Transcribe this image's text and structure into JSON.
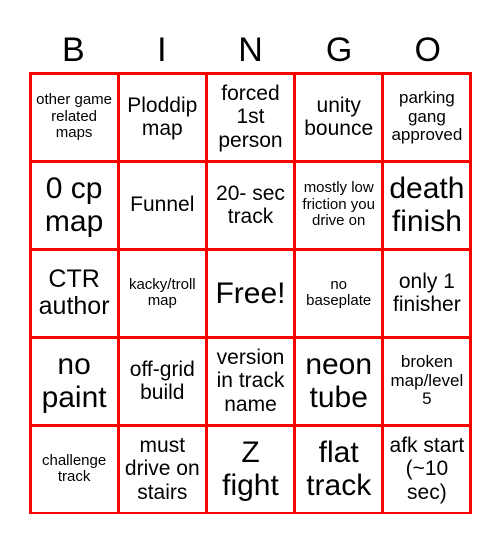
{
  "header": [
    "B",
    "I",
    "N",
    "G",
    "O"
  ],
  "grid_color": "#ff0000",
  "cells": [
    {
      "text": "other game related maps",
      "size": "s1"
    },
    {
      "text": "Ploddip map",
      "size": "s3"
    },
    {
      "text": "forced 1st person",
      "size": "s3"
    },
    {
      "text": "unity bounce",
      "size": "s3"
    },
    {
      "text": "parking gang approved",
      "size": "s2"
    },
    {
      "text": "0 cp map",
      "size": "s5"
    },
    {
      "text": "Funnel",
      "size": "s3"
    },
    {
      "text": "20- sec track",
      "size": "s3"
    },
    {
      "text": "mostly low friction you drive on",
      "size": "s1"
    },
    {
      "text": "death finish",
      "size": "s5"
    },
    {
      "text": "CTR author",
      "size": "s4"
    },
    {
      "text": "kacky/troll map",
      "size": "s1"
    },
    {
      "text": "Free!",
      "size": "s5"
    },
    {
      "text": "no baseplate",
      "size": "s1"
    },
    {
      "text": "only 1 finisher",
      "size": "s3"
    },
    {
      "text": "no paint",
      "size": "s5"
    },
    {
      "text": "off-grid build",
      "size": "s3"
    },
    {
      "text": "version in track name",
      "size": "s3"
    },
    {
      "text": "neon tube",
      "size": "s5"
    },
    {
      "text": "broken map/level 5",
      "size": "s2"
    },
    {
      "text": "challenge track",
      "size": "s1"
    },
    {
      "text": "must drive on stairs",
      "size": "s3"
    },
    {
      "text": "Z fight",
      "size": "s5"
    },
    {
      "text": "flat track",
      "size": "s5"
    },
    {
      "text": "afk start (~10 sec)",
      "size": "s3"
    }
  ]
}
